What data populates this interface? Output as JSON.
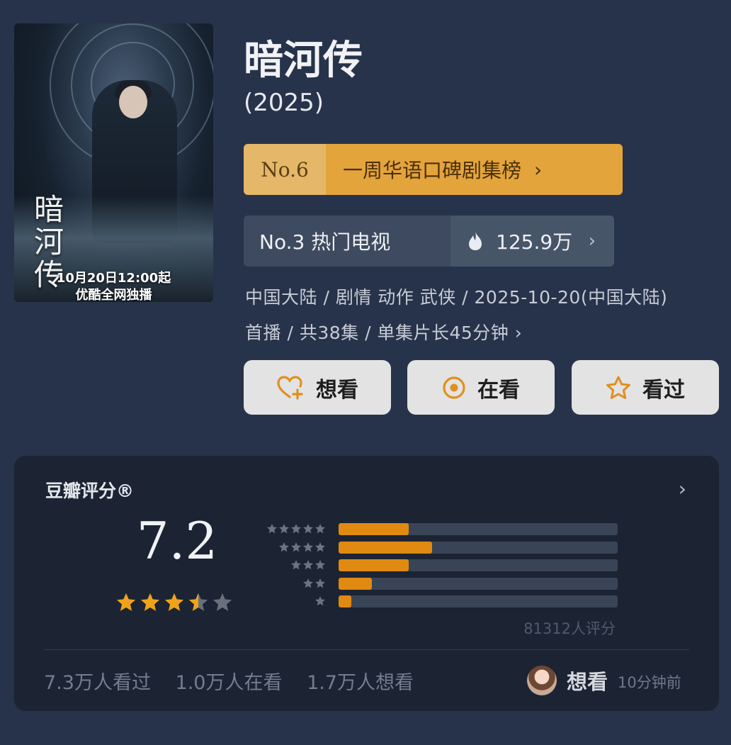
{
  "poster": {
    "vertical_title": "暗河传",
    "release_line": "10月20日12:00起",
    "platform_line": "优酷全网独播"
  },
  "show": {
    "title": "暗河传",
    "year": "(2025)"
  },
  "ranks": {
    "weekly": {
      "rank": "No.6",
      "label": "一周华语口碑剧集榜",
      "chevron": "›"
    },
    "hot": {
      "rank_label": "No.3 热门电视",
      "heat": "125.9万",
      "chevron": "›",
      "icon": "flame-icon"
    }
  },
  "meta": {
    "line1": "中国大陆 / 剧情 动作 武侠 / 2025-10-20(中国大陆)",
    "line2": "首播 / 共38集 / 单集片长45分钟 ›"
  },
  "actions": [
    {
      "label": "想看",
      "icon": "heart-plus-icon"
    },
    {
      "label": "在看",
      "icon": "target-circle-icon"
    },
    {
      "label": "看过",
      "icon": "star-outline-icon"
    }
  ],
  "rating": {
    "title": "豆瓣评分®",
    "chevron": "›",
    "score": "7.2",
    "stars_filled": 3.5,
    "stars_total": 5,
    "distribution": [
      {
        "stars": 5,
        "fraction": 0.25
      },
      {
        "stars": 4,
        "fraction": 0.335
      },
      {
        "stars": 3,
        "fraction": 0.25
      },
      {
        "stars": 2,
        "fraction": 0.12
      },
      {
        "stars": 1,
        "fraction": 0.045
      }
    ],
    "count": "81312人评分",
    "stats": [
      "7.3万人看过",
      "1.0万人在看",
      "1.7万人想看"
    ],
    "friend_activity": {
      "action": "想看",
      "time": "10分钟前"
    }
  },
  "colors": {
    "background": "#27334a",
    "card": "#1c2433",
    "accent_orange": "#e08a12",
    "rank_gold": "#e4a43c",
    "star_gold": "#f0a31a",
    "star_empty": "#69707c"
  }
}
